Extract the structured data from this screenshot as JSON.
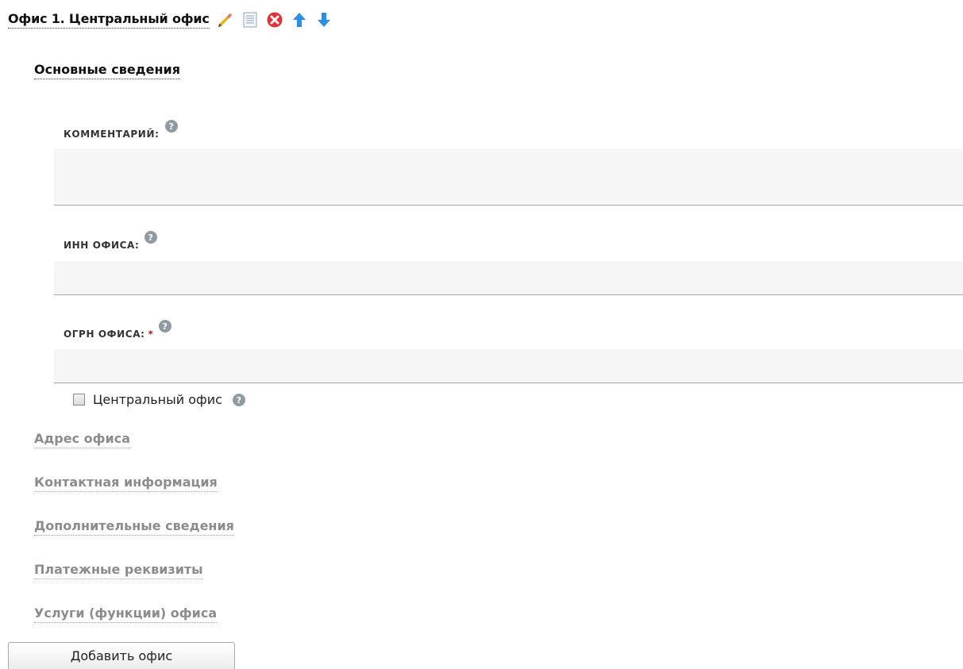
{
  "office": {
    "title": "Офис 1. Центральный офис",
    "icons": [
      "edit-pencil-icon",
      "document-icon",
      "delete-icon",
      "move-up-icon",
      "move-down-icon"
    ]
  },
  "main_section": {
    "title": "Основные сведения",
    "fields": {
      "comment": {
        "label": "КОММЕНТАРИЙ:",
        "value": ""
      },
      "inn": {
        "label": "ИНН ОФИСА:",
        "value": ""
      },
      "ogrn": {
        "label": "ОГРН ОФИСА:",
        "required_mark": "*",
        "value": ""
      }
    },
    "central_office": {
      "label": "Центральный офис",
      "checked": false
    }
  },
  "collapsed_sections": [
    "Адрес офиса",
    "Контактная информация",
    "Дополнительные сведения",
    "Платежные реквизиты",
    "Услуги (функции) офиса"
  ],
  "add_office_button": "Добавить офис",
  "colors": {
    "delete": "#e2333a",
    "arrow": "#2b8fe6",
    "pencil": "#f0b01c",
    "help": "#8f9aa3",
    "required": "#c0141b"
  }
}
